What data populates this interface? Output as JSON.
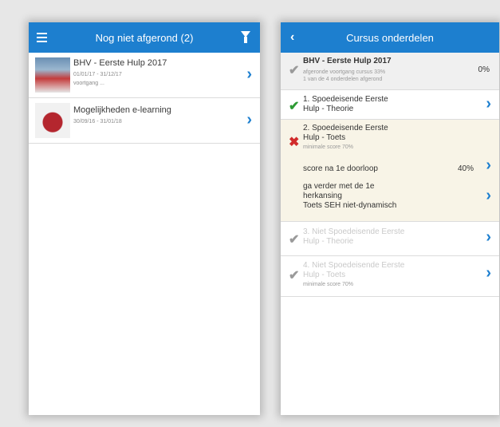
{
  "left_screen": {
    "title": "Nog niet afgerond (2)",
    "courses": [
      {
        "title": "BHV - Eerste Hulp 2017",
        "dates": "01/01/17 - 31/12/17",
        "extra": "voortgang ...",
        "thumbnail_icon": "course-thumbnail"
      },
      {
        "title": "Mogelijkheden e-learning",
        "dates": "30/09/16 - 31/01/18",
        "thumbnail_icon": "course-thumbnail"
      }
    ]
  },
  "right_screen": {
    "title": "Cursus onderdelen",
    "course": {
      "title": "BHV - Eerste Hulp 2017",
      "line1": "afgeronde voortgang cursus 33%",
      "line2": "1 van de 4 onderdelen afgerond",
      "percent": "0%"
    },
    "items": [
      {
        "title_l1": "1. Spoedeisende Eerste",
        "title_l2": "Hulp - Theorie",
        "status": "ok"
      },
      {
        "title_l1": "2. Spoedeisende Eerste",
        "title_l2": "Hulp - Toets",
        "sub": "minimale score 70%",
        "status": "fail"
      },
      {
        "label": "score na 1e doorloop",
        "value": "40%"
      },
      {
        "l1": "ga verder met de 1e",
        "l2": "herkansing",
        "l3": "Toets SEH niet-dynamisch"
      },
      {
        "title_l1": "3. Niet Spoedeisende Eerste",
        "title_l2": "Hulp - Theorie",
        "status": "muted"
      },
      {
        "title_l1": "4. Niet Spoedeisende Eerste",
        "title_l2": "Hulp - Toets",
        "sub": "minimale score 70%",
        "status": "muted"
      }
    ]
  }
}
